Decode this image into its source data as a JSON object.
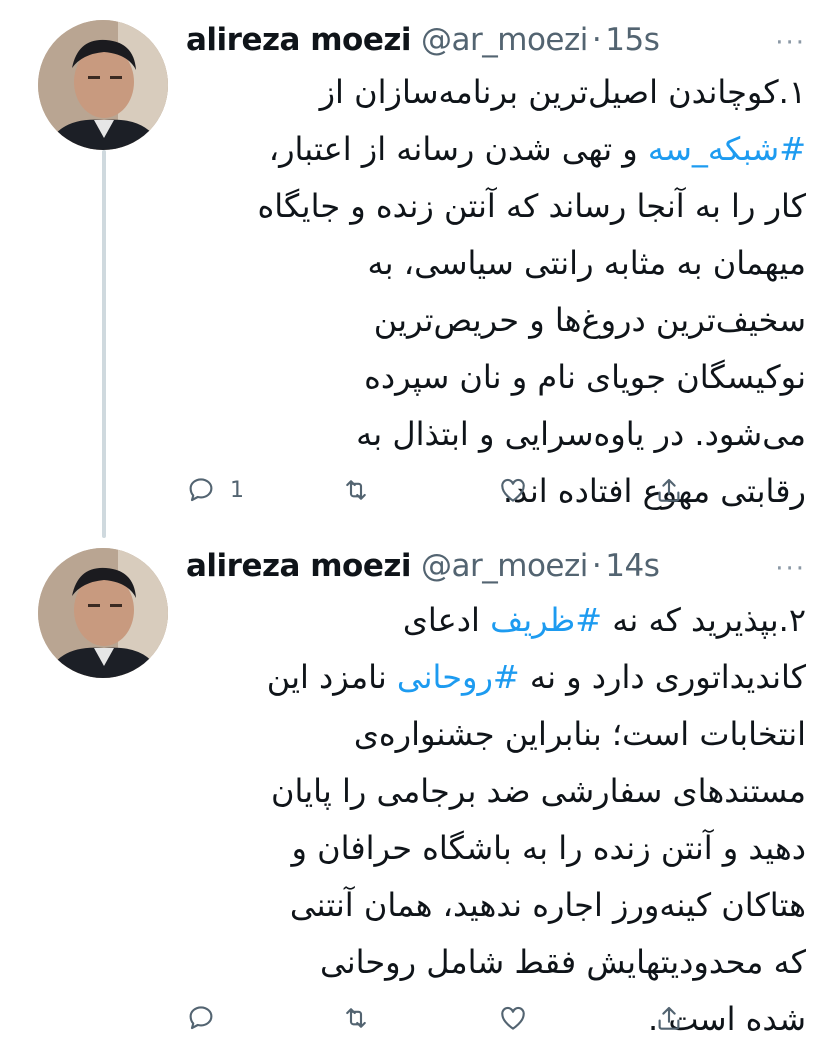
{
  "tweets": [
    {
      "author": {
        "name": "alireza moezi",
        "handle": "@ar_moezi"
      },
      "separator": "·",
      "time": "15s",
      "more": "···",
      "lines": [
        [
          {
            "text": "۱.کوچاندن اصیل‌ترین برنامه‌سازان از",
            "hashtag": false
          }
        ],
        [
          {
            "text": "#شبکه_سه",
            "hashtag": true
          },
          {
            "text": " و تهی شدن رسانه از اعتبار،",
            "hashtag": false
          }
        ],
        [
          {
            "text": "کار را به آنجا رساند که آنتن زنده و جایگاه",
            "hashtag": false
          }
        ],
        [
          {
            "text": "میهمان به مثابه رانتی سیاسی، به",
            "hashtag": false
          }
        ],
        [
          {
            "text": "سخیف‌ترین دروغ‌ها و حریص‌ترین",
            "hashtag": false
          }
        ],
        [
          {
            "text": "نوکیسگان جویای نام و نان سپرده",
            "hashtag": false
          }
        ],
        [
          {
            "text": "می‌شود.  در یاوه‌سرایی و ابتذال به",
            "hashtag": false
          }
        ],
        [
          {
            "text": "رقابتی مهوع افتاده اند.",
            "hashtag": false
          }
        ]
      ],
      "actions": {
        "reply_count": "1"
      },
      "icons": [
        "reply-icon",
        "retweet-icon",
        "like-icon",
        "share-icon"
      ]
    },
    {
      "author": {
        "name": "alireza moezi",
        "handle": "@ar_moezi"
      },
      "separator": "·",
      "time": "14s",
      "more": "···",
      "lines": [
        [
          {
            "text": "۲.بپذیرید که نه ",
            "hashtag": false
          },
          {
            "text": "#ظریف",
            "hashtag": true
          },
          {
            "text": " ادعای",
            "hashtag": false
          }
        ],
        [
          {
            "text": "کاندیداتوری دارد و نه ",
            "hashtag": false
          },
          {
            "text": "#روحانی",
            "hashtag": true
          },
          {
            "text": " نامزد این",
            "hashtag": false
          }
        ],
        [
          {
            "text": "انتخابات است؛ بنابراین جشنواره‌ی",
            "hashtag": false
          }
        ],
        [
          {
            "text": "مستندهای سفارشی ضد برجامی را پایان",
            "hashtag": false
          }
        ],
        [
          {
            "text": "دهید و آنتن زنده را به باشگاه حرافان و",
            "hashtag": false
          }
        ],
        [
          {
            "text": "هتاکان کینه‌ورز اجاره ندهید، همان آنتنی",
            "hashtag": false
          }
        ],
        [
          {
            "text": "که محدودیتهایش فقط شامل روحانی",
            "hashtag": false
          }
        ],
        [
          {
            "text": "شده است .",
            "hashtag": false
          }
        ]
      ],
      "actions": {
        "reply_count": ""
      },
      "icons": [
        "reply-icon",
        "retweet-icon",
        "like-icon",
        "share-icon"
      ]
    }
  ],
  "colors": {
    "hashtag": "#1d9bf0",
    "muted": "#536471",
    "thread_line": "#cfd9de",
    "text": "#0f1419"
  }
}
